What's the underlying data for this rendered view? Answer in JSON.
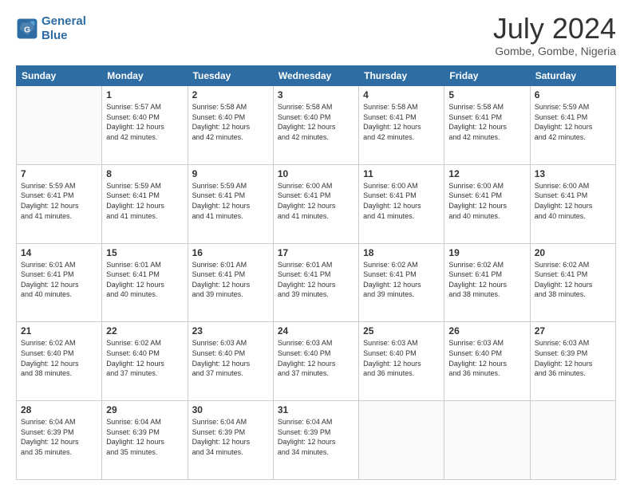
{
  "header": {
    "logo_line1": "General",
    "logo_line2": "Blue",
    "month": "July 2024",
    "location": "Gombe, Gombe, Nigeria"
  },
  "days_of_week": [
    "Sunday",
    "Monday",
    "Tuesday",
    "Wednesday",
    "Thursday",
    "Friday",
    "Saturday"
  ],
  "weeks": [
    [
      {
        "day": "",
        "info": ""
      },
      {
        "day": "1",
        "info": "Sunrise: 5:57 AM\nSunset: 6:40 PM\nDaylight: 12 hours\nand 42 minutes."
      },
      {
        "day": "2",
        "info": "Sunrise: 5:58 AM\nSunset: 6:40 PM\nDaylight: 12 hours\nand 42 minutes."
      },
      {
        "day": "3",
        "info": "Sunrise: 5:58 AM\nSunset: 6:40 PM\nDaylight: 12 hours\nand 42 minutes."
      },
      {
        "day": "4",
        "info": "Sunrise: 5:58 AM\nSunset: 6:41 PM\nDaylight: 12 hours\nand 42 minutes."
      },
      {
        "day": "5",
        "info": "Sunrise: 5:58 AM\nSunset: 6:41 PM\nDaylight: 12 hours\nand 42 minutes."
      },
      {
        "day": "6",
        "info": "Sunrise: 5:59 AM\nSunset: 6:41 PM\nDaylight: 12 hours\nand 42 minutes."
      }
    ],
    [
      {
        "day": "7",
        "info": "Sunrise: 5:59 AM\nSunset: 6:41 PM\nDaylight: 12 hours\nand 41 minutes."
      },
      {
        "day": "8",
        "info": "Sunrise: 5:59 AM\nSunset: 6:41 PM\nDaylight: 12 hours\nand 41 minutes."
      },
      {
        "day": "9",
        "info": "Sunrise: 5:59 AM\nSunset: 6:41 PM\nDaylight: 12 hours\nand 41 minutes."
      },
      {
        "day": "10",
        "info": "Sunrise: 6:00 AM\nSunset: 6:41 PM\nDaylight: 12 hours\nand 41 minutes."
      },
      {
        "day": "11",
        "info": "Sunrise: 6:00 AM\nSunset: 6:41 PM\nDaylight: 12 hours\nand 41 minutes."
      },
      {
        "day": "12",
        "info": "Sunrise: 6:00 AM\nSunset: 6:41 PM\nDaylight: 12 hours\nand 40 minutes."
      },
      {
        "day": "13",
        "info": "Sunrise: 6:00 AM\nSunset: 6:41 PM\nDaylight: 12 hours\nand 40 minutes."
      }
    ],
    [
      {
        "day": "14",
        "info": "Sunrise: 6:01 AM\nSunset: 6:41 PM\nDaylight: 12 hours\nand 40 minutes."
      },
      {
        "day": "15",
        "info": "Sunrise: 6:01 AM\nSunset: 6:41 PM\nDaylight: 12 hours\nand 40 minutes."
      },
      {
        "day": "16",
        "info": "Sunrise: 6:01 AM\nSunset: 6:41 PM\nDaylight: 12 hours\nand 39 minutes."
      },
      {
        "day": "17",
        "info": "Sunrise: 6:01 AM\nSunset: 6:41 PM\nDaylight: 12 hours\nand 39 minutes."
      },
      {
        "day": "18",
        "info": "Sunrise: 6:02 AM\nSunset: 6:41 PM\nDaylight: 12 hours\nand 39 minutes."
      },
      {
        "day": "19",
        "info": "Sunrise: 6:02 AM\nSunset: 6:41 PM\nDaylight: 12 hours\nand 38 minutes."
      },
      {
        "day": "20",
        "info": "Sunrise: 6:02 AM\nSunset: 6:41 PM\nDaylight: 12 hours\nand 38 minutes."
      }
    ],
    [
      {
        "day": "21",
        "info": "Sunrise: 6:02 AM\nSunset: 6:40 PM\nDaylight: 12 hours\nand 38 minutes."
      },
      {
        "day": "22",
        "info": "Sunrise: 6:02 AM\nSunset: 6:40 PM\nDaylight: 12 hours\nand 37 minutes."
      },
      {
        "day": "23",
        "info": "Sunrise: 6:03 AM\nSunset: 6:40 PM\nDaylight: 12 hours\nand 37 minutes."
      },
      {
        "day": "24",
        "info": "Sunrise: 6:03 AM\nSunset: 6:40 PM\nDaylight: 12 hours\nand 37 minutes."
      },
      {
        "day": "25",
        "info": "Sunrise: 6:03 AM\nSunset: 6:40 PM\nDaylight: 12 hours\nand 36 minutes."
      },
      {
        "day": "26",
        "info": "Sunrise: 6:03 AM\nSunset: 6:40 PM\nDaylight: 12 hours\nand 36 minutes."
      },
      {
        "day": "27",
        "info": "Sunrise: 6:03 AM\nSunset: 6:39 PM\nDaylight: 12 hours\nand 36 minutes."
      }
    ],
    [
      {
        "day": "28",
        "info": "Sunrise: 6:04 AM\nSunset: 6:39 PM\nDaylight: 12 hours\nand 35 minutes."
      },
      {
        "day": "29",
        "info": "Sunrise: 6:04 AM\nSunset: 6:39 PM\nDaylight: 12 hours\nand 35 minutes."
      },
      {
        "day": "30",
        "info": "Sunrise: 6:04 AM\nSunset: 6:39 PM\nDaylight: 12 hours\nand 34 minutes."
      },
      {
        "day": "31",
        "info": "Sunrise: 6:04 AM\nSunset: 6:39 PM\nDaylight: 12 hours\nand 34 minutes."
      },
      {
        "day": "",
        "info": ""
      },
      {
        "day": "",
        "info": ""
      },
      {
        "day": "",
        "info": ""
      }
    ]
  ]
}
